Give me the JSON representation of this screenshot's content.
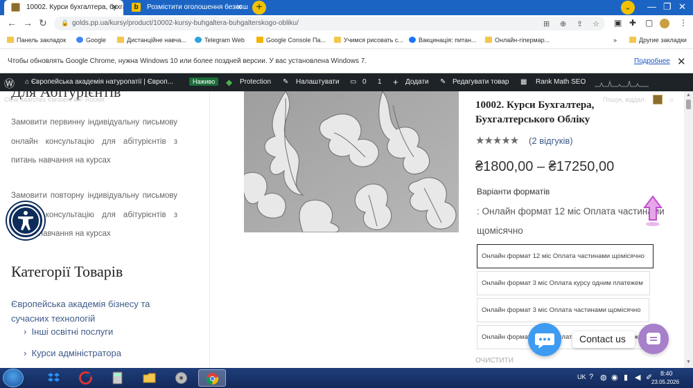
{
  "colors": {
    "tabstrip": "#1c64c4",
    "admin_bar": "#1d2327",
    "link_blue": "#3d5a8a",
    "chat_blue": "#3d9bf2",
    "contact_purple": "#a77fcb",
    "taskbar": "#1f3e7a",
    "accessibility": "#0d2c5a"
  },
  "browser": {
    "tabs": [
      {
        "title": "10002. Курси бухгалтера, бухгал",
        "icon": "site-favicon",
        "active": true
      },
      {
        "title": "Розмістити оголошення безкош",
        "icon": "b-favicon",
        "active": false
      }
    ],
    "url": "golds.pp.ua/kursy/product/10002-kursy-buhgaltera-buhgalterskogo-obliku/",
    "bookmarks": [
      "Панель закладок",
      "Google",
      "Дистанційне навча...",
      "Telegram Web",
      "Google Console Па...",
      "Учимся рисовать с...",
      "Вакцинація: питан...",
      "Онлайн-гіпермар..."
    ],
    "other_bookmarks": "Другие закладки",
    "infobar": {
      "message": "Чтобы обновлять Google Chrome, нужна Windows 10 или более поздней версии. У вас установлена Windows 7.",
      "link": "Подробнее"
    }
  },
  "adminbar": {
    "site_name": "Європейська академія натуропатії | Європ...",
    "live_badge": "Наживо",
    "protection": "Protection",
    "customize": "Налаштувати",
    "comments_count": "0",
    "updates_count": "1",
    "add_new": "Додати",
    "edit_product": "Редагувати товар",
    "rank_math": "Rank Math SEO"
  },
  "sidebar": {
    "cut_title": "Для Абітурієнтів",
    "faint_labels": "Clear searches transient    WP Rocket",
    "para1": "Замовити первинну індивідуальну письмову онлайн консультацію для абітурієнтів з питань навчання на курсах",
    "para2": "Замовити повторну індивідуальну письмову онлайн консультацію для абітурієнтів з питань навчання на курсах",
    "categories_title": "Категорії Товарів",
    "category_main": "Європейська академія бізнесу та сучасних технологій",
    "subcategories": [
      "Інші освітні послуги",
      "Курси адміністратора"
    ]
  },
  "product": {
    "title": "10002. Курси Бухгалтера, Бухгалтерського Обліку",
    "rating": 5,
    "stars": "★★★★★",
    "reviews_open": "(",
    "reviews_count": "2",
    "reviews_rest": " відгуків)",
    "price": "₴1800,00 – ₴17250,00",
    "variants_label": "Варіанти форматів",
    "selected_variant_text": ": Онлайн формат 12 міс Оплата частинами щомісячно",
    "variants": [
      "Онлайн формат 12 міс Оплата частинами щомісячно",
      "Онлайн формат 3 міс Оплата курсу одним платежем",
      "Онлайн формат 3 міс Оплата частинами щомісячно",
      "Онлайн формат 12 міс Оплата курсу одним платежем"
    ],
    "clear_label": "ОЧИСТИТИ"
  },
  "page_header": {
    "search_hint": "Пошук, віддал"
  },
  "widgets": {
    "contact_label": "Contact us"
  },
  "taskbar": {
    "language": "UK",
    "time": "8:40",
    "date": "23.05.2026"
  }
}
